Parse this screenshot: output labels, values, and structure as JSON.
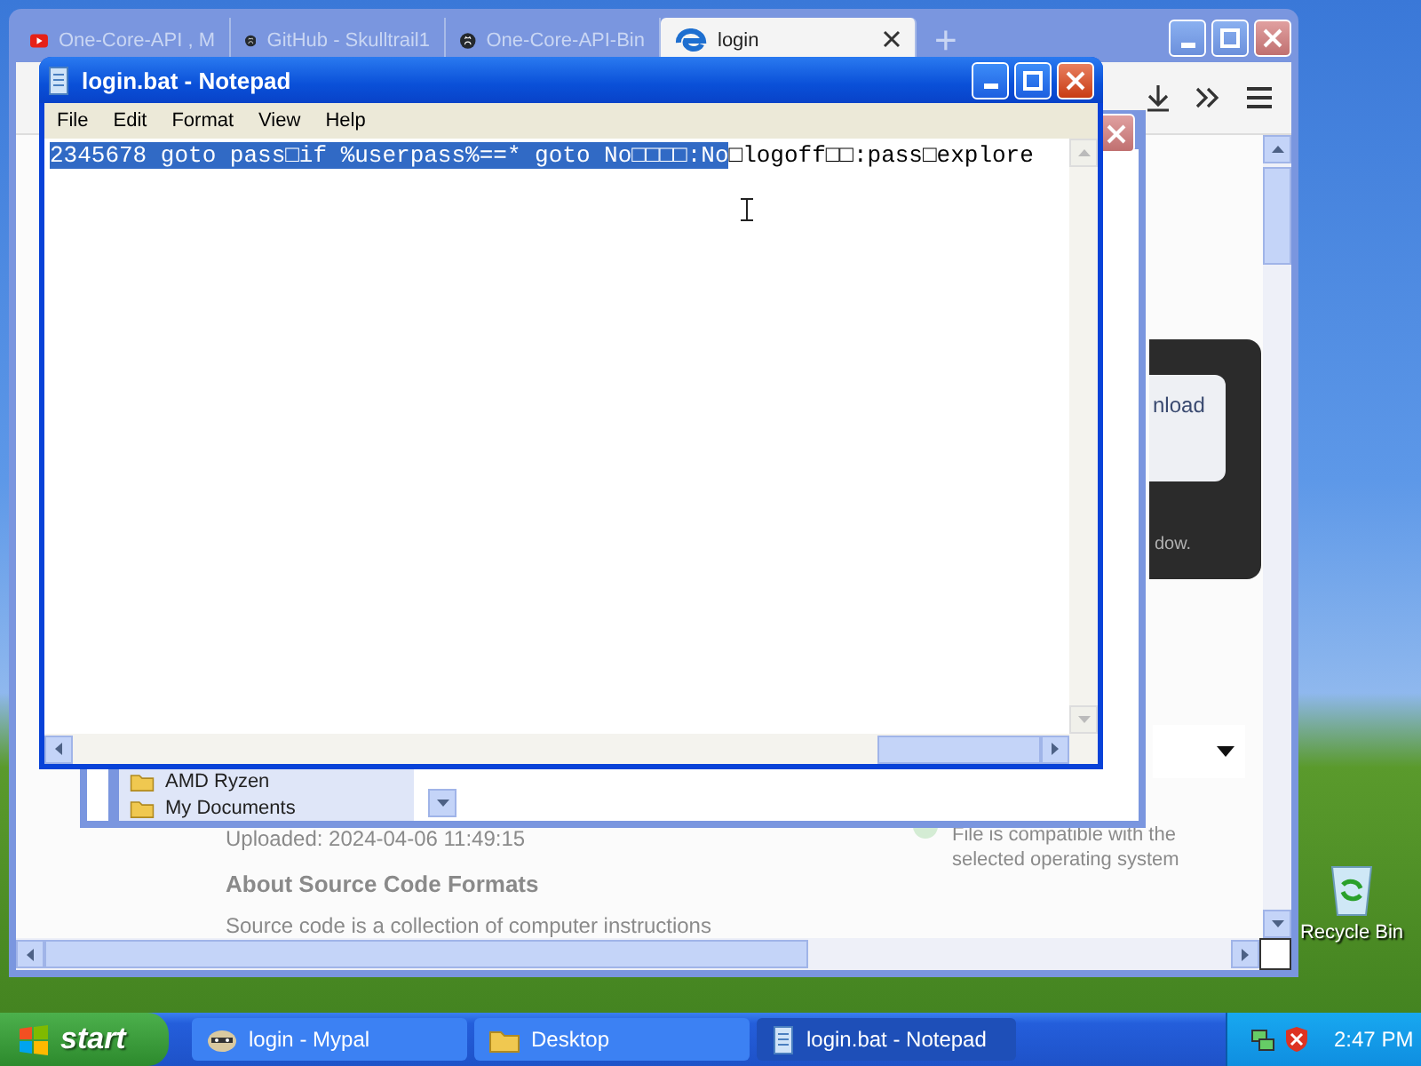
{
  "browser": {
    "tabs": [
      {
        "kind": "video",
        "label": "One-Core-API , M",
        "selected": false
      },
      {
        "kind": "code",
        "label": "GitHub - Skulltrail1",
        "selected": false
      },
      {
        "kind": "code",
        "label": "One-Core-API-Bin",
        "selected": false
      },
      {
        "kind": "site",
        "label": "login",
        "selected": true
      }
    ],
    "new_tab": "+",
    "page": {
      "download_button": "nload",
      "notice": "dow.",
      "compat_note": "File is compatible with the selected operating system",
      "uploaded": "Uploaded: 2024-04-06 11:49:15",
      "heading": "About Source Code Formats",
      "paragraph": "Source code is a collection of computer instructions"
    }
  },
  "file_dialog": {
    "folders": [
      "AMD Ryzen",
      "My Documents"
    ]
  },
  "notepad": {
    "title": "login.bat - Notepad",
    "menu": [
      "File",
      "Edit",
      "Format",
      "View",
      "Help"
    ],
    "selected_text": "2345678 goto pass□if %userpass%==* goto No□□□□:No",
    "rest_text": "□logoff□□:pass□explore"
  },
  "desktop_icons": [
    {
      "label": "Recycle Bin"
    }
  ],
  "taskbar": {
    "start": "start",
    "tasks": [
      {
        "kind": "browser",
        "label": "login - Mypal",
        "selected": false
      },
      {
        "kind": "folder",
        "label": "Desktop",
        "selected": false
      },
      {
        "kind": "notepad",
        "label": "login.bat - Notepad",
        "selected": true
      }
    ],
    "clock": "2:47 PM"
  }
}
